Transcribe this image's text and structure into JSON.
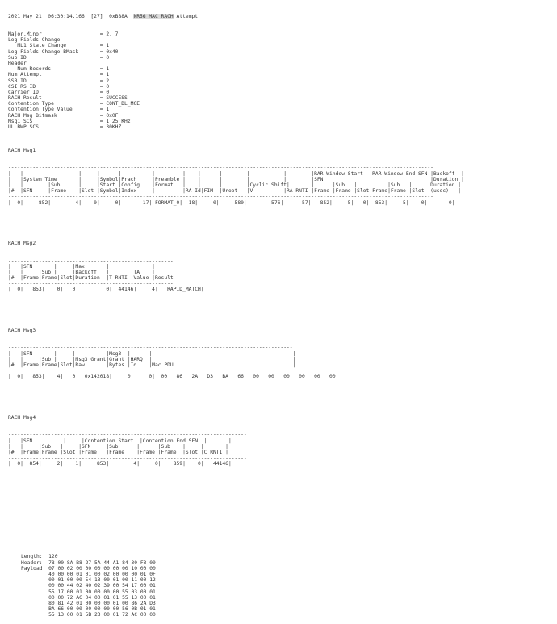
{
  "header": {
    "prefix": "2021 May 21  06:30:14.166  [27]  0xB88A  ",
    "highlight": "NR5G MAC RACH",
    "suffix": " Attempt"
  },
  "fields": [
    "Major.Minor                   = 2. 7",
    "Log Fields Change",
    "   ML1 State Change           = 1",
    "Log Fields Change BMask       = 0x40",
    "Sub ID                        = 0",
    "Header",
    "   Num Records                = 1",
    "Num Attempt                   = 1",
    "SSB ID                        = 2",
    "CSI RS ID                     = 0",
    "Carrier ID                    = 0",
    "RACH Result                   = SUCCESS",
    "Contention Type               = CONT_DL_MCE",
    "Contention Type Value         = 1",
    "RACH Msg Bitmask              = 0x0F",
    "Msg1 SCS                      = 1_25 KHz",
    "UL BWP SCS                    = 30KHZ"
  ],
  "msg1": {
    "title": "RACH Msg1",
    "table": [
      "-------------------------------------------------------------------------------------------------------------------------------------------",
      "|   |                  |     |      |          |         |    |      |        |           |        |RAR Window Start  |RAR Window End SFN |Backoff  |",
      "|   |System Time       |     |Symbol|Prach     |Preamble |    |      |        |           |        |SFN               |                   |Duration |",
      "|   |        |Sub      |     |Start |Config    |Format   |    |      |        |Cyclic Shift|       |      |Sub   |    |     |Sub   |     |Duration |",
      "|#  |SFN     |Frame    |Slot |Symbol|Index     |         |RA Id|FIM  |Uroot   |V          |RA RNTI |Frame |Frame |Slot|Frame|Frame |Slot |(usec)   |",
      "-------------------------------------------------------------------------------------------------------------------------------------------",
      "|  0|     852|        4|    0|     0|       17| FORMAT_0|  18|     0|     580|        576|      57|   852|     5|   0|  853|     5|    0|       0|"
    ]
  },
  "msg2": {
    "title": "RACH Msg2",
    "table": [
      "------------------------------------------------------",
      "|   |SFN       |     |Max       |       |      |       |",
      "|   |     |Sub |     |Backoff   |       |TA    |       |",
      "|#  |Frame|Frame|Slot|Duration  |T RNTI |Value |Result |",
      "------------------------------------------------------",
      "|  0|   853|    0|   0|         0|  44146|     4|   RAPID_MATCH|"
    ]
  },
  "msg3": {
    "title": "RACH Msg3",
    "table": [
      "---------------------------------------------------------------------------------------------",
      "|   |SFN       |     |          |Msg3  |      |                                              |",
      "|   |     |Sub |     |Msg3 Grant|Grant |HARQ  |                                              |",
      "|#  |Frame|Frame|Slot|Raw       |Bytes |Id    |Mac PDU                                       |",
      "---------------------------------------------------------------------------------------------",
      "|  0|   853|    4|   0|  0x142018|     0|     0|  00   86   2A   D3   BA   66   00   00   00   00   00   00|"
    ]
  },
  "msg4": {
    "title": "RACH Msg4",
    "table": [
      "------------------------------------------------------------------------------",
      "|   |SFN          |     |Contention Start  |Contention End SFN  |       |",
      "|   |     |Sub   |     |SFN     |Sub      |      |Sub    |     |       |",
      "|#  |Frame|Frame |Slot |Frame   |Frame    |Frame |Frame  |Slot |C RNTI |",
      "------------------------------------------------------------------------------",
      "|  0|  854|     2|    1|     853|        4|     0|    859|    0|   44146|"
    ]
  },
  "hex": [
    "Length:  120",
    "Header:  78 00 8A B8 27 5A 44 A1 84 30 F3 00",
    "Payload: 07 00 02 00 00 00 00 00 00 10 00 00",
    "         40 00 00 01 01 00 02 00 00 00 01 0F",
    "         00 01 00 00 54 13 00 01 00 11 00 12",
    "         00 00 44 02 40 02 39 00 54 17 00 01",
    "         55 17 00 01 00 00 00 00 55 03 00 01",
    "         00 00 72 AC 04 00 01 01 55 13 00 01",
    "         80 81 42 01 00 00 00 01 00 86 2A D3",
    "         BA 66 00 00 00 00 00 00 56 0B 01 01",
    "         55 13 00 01 5B 23 00 01 72 AC 00 00"
  ]
}
